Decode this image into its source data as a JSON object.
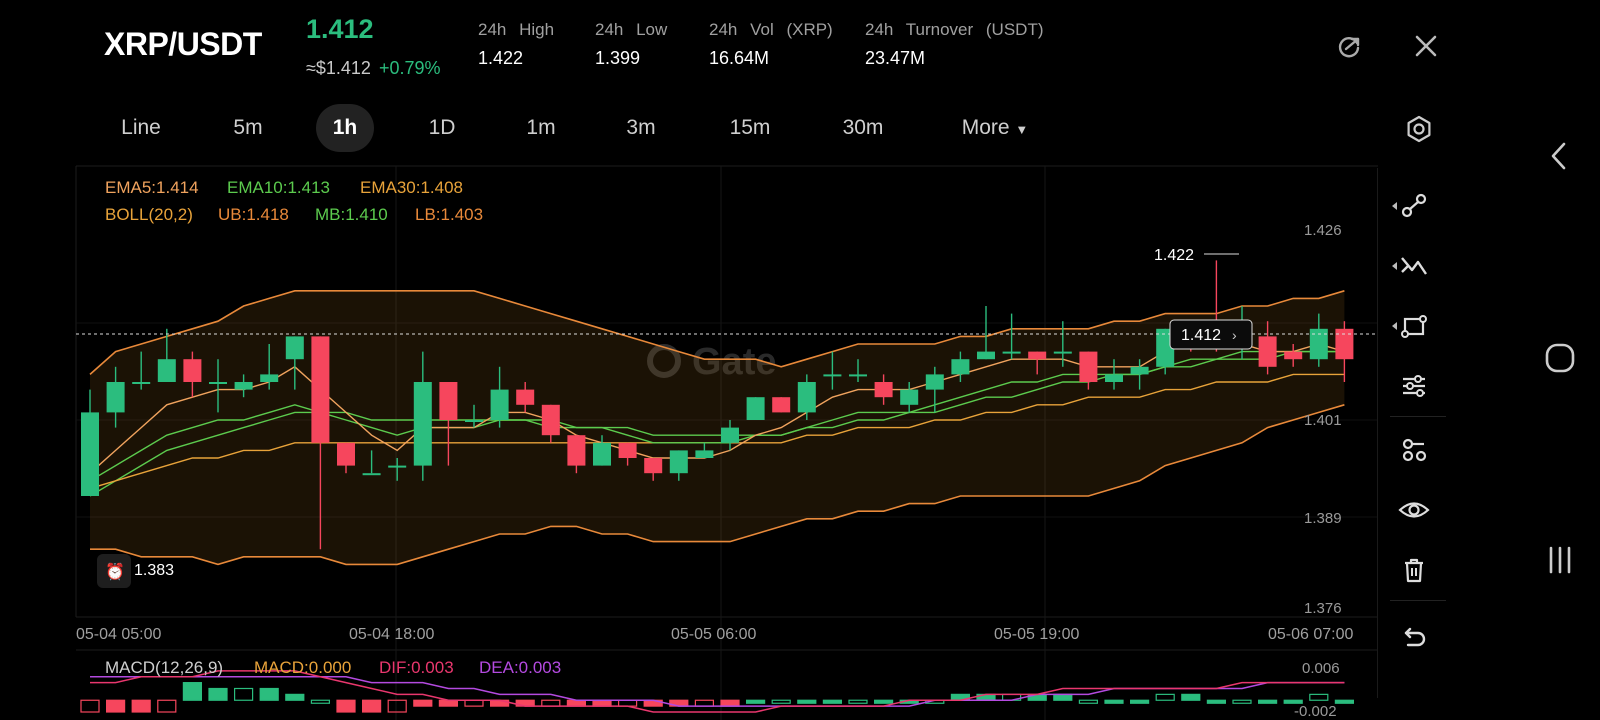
{
  "header": {
    "pair": "XRP/USDT",
    "price": "1.412",
    "usd_price": "≈$1.412",
    "change": "+0.79%",
    "stats": [
      {
        "label": "24h High",
        "value": "1.422"
      },
      {
        "label": "24h Low",
        "value": "1.399"
      },
      {
        "label": "24h Vol (XRP)",
        "value": "16.64M"
      },
      {
        "label": "24h Turnover (USDT)",
        "value": "23.47M"
      }
    ]
  },
  "intervals": [
    "Line",
    "5m",
    "1h",
    "1D",
    "1m",
    "3m",
    "15m",
    "30m",
    "More"
  ],
  "active_interval": "1h",
  "indicators": {
    "ema5": "EMA5:1.414",
    "ema10": "EMA10:1.413",
    "ema30": "EMA30:1.408",
    "boll": "BOLL(20,2)",
    "ub": "UB:1.418",
    "mb": "MB:1.410",
    "lb": "LB:1.403"
  },
  "macd": {
    "label": "MACD(12,26,9)",
    "macd": "MACD:0.000",
    "dif": "DIF:0.003",
    "dea": "DEA:0.003",
    "y_top": "0.006",
    "y_bottom": "-0.002"
  },
  "price_axis": [
    "1.426",
    "1.401",
    "1.389",
    "1.376"
  ],
  "time_axis": [
    "05-04 05:00",
    "05-04 18:00",
    "05-05 06:00",
    "05-05 19:00",
    "05-06 07:00"
  ],
  "markers": {
    "high": "1.422",
    "low": "1.383",
    "current": "1.412"
  },
  "watermark": "Gate",
  "colors": {
    "up": "#2bbd7e",
    "down": "#f6465d",
    "ema5": "#f0a35e",
    "ema10": "#5ccb4e",
    "ema30": "#e8a33a",
    "boll": "#e8893a",
    "dif": "#e9376e",
    "dea": "#b44ae0",
    "background": "#000000"
  },
  "toolbar_icons": [
    "draw-trend-icon",
    "draw-cross-icon",
    "draw-shape-icon",
    "indicator-settings-icon",
    "template-icon",
    "eye-icon",
    "trash-icon",
    "undo-icon"
  ],
  "chart_data": {
    "type": "candlestick",
    "interval": "1h",
    "ylim": [
      1.376,
      1.426
    ],
    "candles": [
      {
        "o": 1.391,
        "h": 1.405,
        "c": 1.402,
        "l": 1.391
      },
      {
        "o": 1.402,
        "h": 1.408,
        "c": 1.406,
        "l": 1.4
      },
      {
        "o": 1.406,
        "h": 1.41,
        "c": 1.406,
        "l": 1.405
      },
      {
        "o": 1.406,
        "h": 1.413,
        "c": 1.409,
        "l": 1.406
      },
      {
        "o": 1.409,
        "h": 1.41,
        "c": 1.406,
        "l": 1.404
      },
      {
        "o": 1.406,
        "h": 1.409,
        "c": 1.406,
        "l": 1.402
      },
      {
        "o": 1.405,
        "h": 1.407,
        "c": 1.406,
        "l": 1.404
      },
      {
        "o": 1.406,
        "h": 1.411,
        "c": 1.407,
        "l": 1.405
      },
      {
        "o": 1.409,
        "h": 1.412,
        "c": 1.412,
        "l": 1.405
      },
      {
        "o": 1.412,
        "h": 1.412,
        "c": 1.398,
        "l": 1.384
      },
      {
        "o": 1.398,
        "h": 1.398,
        "c": 1.395,
        "l": 1.394
      },
      {
        "o": 1.394,
        "h": 1.397,
        "c": 1.394,
        "l": 1.394
      },
      {
        "o": 1.395,
        "h": 1.396,
        "c": 1.395,
        "l": 1.393
      },
      {
        "o": 1.395,
        "h": 1.41,
        "c": 1.406,
        "l": 1.393
      },
      {
        "o": 1.406,
        "h": 1.406,
        "c": 1.401,
        "l": 1.395
      },
      {
        "o": 1.401,
        "h": 1.403,
        "c": 1.401,
        "l": 1.4
      },
      {
        "o": 1.401,
        "h": 1.408,
        "c": 1.405,
        "l": 1.4
      },
      {
        "o": 1.405,
        "h": 1.406,
        "c": 1.403,
        "l": 1.402
      },
      {
        "o": 1.403,
        "h": 1.403,
        "c": 1.399,
        "l": 1.398
      },
      {
        "o": 1.399,
        "h": 1.399,
        "c": 1.395,
        "l": 1.394
      },
      {
        "o": 1.395,
        "h": 1.399,
        "c": 1.398,
        "l": 1.395
      },
      {
        "o": 1.398,
        "h": 1.398,
        "c": 1.396,
        "l": 1.395
      },
      {
        "o": 1.396,
        "h": 1.396,
        "c": 1.394,
        "l": 1.393
      },
      {
        "o": 1.394,
        "h": 1.397,
        "c": 1.397,
        "l": 1.393
      },
      {
        "o": 1.396,
        "h": 1.398,
        "c": 1.397,
        "l": 1.396
      },
      {
        "o": 1.398,
        "h": 1.401,
        "c": 1.4,
        "l": 1.397
      },
      {
        "o": 1.401,
        "h": 1.404,
        "c": 1.404,
        "l": 1.401
      },
      {
        "o": 1.404,
        "h": 1.404,
        "c": 1.402,
        "l": 1.402
      },
      {
        "o": 1.402,
        "h": 1.407,
        "c": 1.406,
        "l": 1.401
      },
      {
        "o": 1.407,
        "h": 1.41,
        "c": 1.407,
        "l": 1.405
      },
      {
        "o": 1.407,
        "h": 1.409,
        "c": 1.407,
        "l": 1.406
      },
      {
        "o": 1.406,
        "h": 1.407,
        "c": 1.404,
        "l": 1.403
      },
      {
        "o": 1.403,
        "h": 1.406,
        "c": 1.405,
        "l": 1.402
      },
      {
        "o": 1.405,
        "h": 1.408,
        "c": 1.407,
        "l": 1.402
      },
      {
        "o": 1.407,
        "h": 1.41,
        "c": 1.409,
        "l": 1.406
      },
      {
        "o": 1.409,
        "h": 1.416,
        "c": 1.41,
        "l": 1.409
      },
      {
        "o": 1.41,
        "h": 1.415,
        "c": 1.41,
        "l": 1.409
      },
      {
        "o": 1.41,
        "h": 1.41,
        "c": 1.409,
        "l": 1.407
      },
      {
        "o": 1.41,
        "h": 1.414,
        "c": 1.41,
        "l": 1.408
      },
      {
        "o": 1.41,
        "h": 1.41,
        "c": 1.406,
        "l": 1.405
      },
      {
        "o": 1.406,
        "h": 1.409,
        "c": 1.407,
        "l": 1.405
      },
      {
        "o": 1.407,
        "h": 1.409,
        "c": 1.408,
        "l": 1.405
      },
      {
        "o": 1.408,
        "h": 1.413,
        "c": 1.413,
        "l": 1.407
      },
      {
        "o": 1.413,
        "h": 1.414,
        "c": 1.412,
        "l": 1.41
      },
      {
        "o": 1.412,
        "h": 1.422,
        "c": 1.411,
        "l": 1.41
      },
      {
        "o": 1.411,
        "h": 1.416,
        "c": 1.412,
        "l": 1.409
      },
      {
        "o": 1.412,
        "h": 1.414,
        "c": 1.408,
        "l": 1.407
      },
      {
        "o": 1.41,
        "h": 1.411,
        "c": 1.409,
        "l": 1.408
      },
      {
        "o": 1.409,
        "h": 1.415,
        "c": 1.413,
        "l": 1.408
      },
      {
        "o": 1.413,
        "h": 1.414,
        "c": 1.409,
        "l": 1.406
      }
    ],
    "ema5": [
      1.394,
      1.397,
      1.4,
      1.403,
      1.404,
      1.405,
      1.405,
      1.406,
      1.408,
      1.405,
      1.402,
      1.399,
      1.397,
      1.4,
      1.4,
      1.4,
      1.402,
      1.402,
      1.401,
      1.399,
      1.398,
      1.397,
      1.396,
      1.396,
      1.396,
      1.397,
      1.399,
      1.4,
      1.402,
      1.404,
      1.405,
      1.405,
      1.405,
      1.406,
      1.407,
      1.408,
      1.409,
      1.409,
      1.409,
      1.408,
      1.408,
      1.408,
      1.41,
      1.411,
      1.411,
      1.411,
      1.41,
      1.41,
      1.411,
      1.41
    ],
    "ema10": [
      1.393,
      1.395,
      1.397,
      1.399,
      1.4,
      1.401,
      1.401,
      1.402,
      1.403,
      1.402,
      1.401,
      1.4,
      1.399,
      1.4,
      1.4,
      1.4,
      1.401,
      1.401,
      1.401,
      1.4,
      1.4,
      1.399,
      1.398,
      1.398,
      1.398,
      1.398,
      1.399,
      1.399,
      1.4,
      1.401,
      1.402,
      1.402,
      1.402,
      1.403,
      1.404,
      1.405,
      1.406,
      1.406,
      1.407,
      1.407,
      1.407,
      1.407,
      1.408,
      1.409,
      1.409,
      1.41,
      1.41,
      1.41,
      1.41,
      1.41
    ],
    "ema30": [
      1.392,
      1.393,
      1.394,
      1.395,
      1.396,
      1.396,
      1.397,
      1.397,
      1.398,
      1.398,
      1.398,
      1.398,
      1.398,
      1.398,
      1.398,
      1.398,
      1.398,
      1.398,
      1.398,
      1.398,
      1.398,
      1.398,
      1.398,
      1.398,
      1.398,
      1.398,
      1.398,
      1.398,
      1.399,
      1.399,
      1.4,
      1.4,
      1.4,
      1.401,
      1.401,
      1.402,
      1.402,
      1.403,
      1.403,
      1.404,
      1.404,
      1.404,
      1.405,
      1.405,
      1.406,
      1.406,
      1.406,
      1.407,
      1.407,
      1.407
    ],
    "boll_ub": [
      1.407,
      1.41,
      1.411,
      1.412,
      1.413,
      1.414,
      1.416,
      1.417,
      1.418,
      1.418,
      1.418,
      1.418,
      1.418,
      1.418,
      1.418,
      1.418,
      1.417,
      1.416,
      1.415,
      1.414,
      1.413,
      1.412,
      1.411,
      1.41,
      1.409,
      1.409,
      1.409,
      1.408,
      1.409,
      1.41,
      1.411,
      1.411,
      1.411,
      1.411,
      1.412,
      1.412,
      1.413,
      1.413,
      1.413,
      1.413,
      1.414,
      1.414,
      1.415,
      1.415,
      1.415,
      1.416,
      1.416,
      1.417,
      1.417,
      1.418
    ],
    "boll_mb": [
      1.391,
      1.393,
      1.395,
      1.397,
      1.398,
      1.399,
      1.4,
      1.401,
      1.402,
      1.402,
      1.402,
      1.401,
      1.401,
      1.401,
      1.401,
      1.401,
      1.401,
      1.401,
      1.4,
      1.4,
      1.4,
      1.4,
      1.399,
      1.399,
      1.399,
      1.399,
      1.399,
      1.399,
      1.4,
      1.4,
      1.401,
      1.401,
      1.402,
      1.402,
      1.403,
      1.404,
      1.404,
      1.405,
      1.406,
      1.406,
      1.407,
      1.407,
      1.408,
      1.408,
      1.409,
      1.409,
      1.409,
      1.41,
      1.41,
      1.41
    ],
    "boll_lb": [
      1.384,
      1.384,
      1.383,
      1.383,
      1.383,
      1.382,
      1.383,
      1.383,
      1.383,
      1.383,
      1.382,
      1.382,
      1.382,
      1.383,
      1.384,
      1.385,
      1.386,
      1.386,
      1.387,
      1.387,
      1.386,
      1.386,
      1.385,
      1.385,
      1.385,
      1.385,
      1.386,
      1.387,
      1.388,
      1.388,
      1.389,
      1.389,
      1.39,
      1.39,
      1.391,
      1.391,
      1.391,
      1.391,
      1.391,
      1.391,
      1.392,
      1.393,
      1.395,
      1.396,
      1.397,
      1.398,
      1.4,
      1.401,
      1.402,
      1.403
    ],
    "macd_hist": [
      -0.002,
      -0.002,
      -0.002,
      -0.002,
      0.003,
      0.002,
      0.002,
      0.002,
      0.001,
      0.0,
      -0.002,
      -0.002,
      -0.002,
      -0.001,
      -0.001,
      -0.001,
      -0.001,
      -0.001,
      -0.001,
      -0.001,
      -0.001,
      -0.001,
      -0.001,
      -0.001,
      -0.001,
      -0.001,
      0.0,
      0.0,
      0.0,
      0.0,
      0.0,
      0.0,
      0.0,
      0.0,
      0.001,
      0.001,
      0.001,
      0.001,
      0.001,
      0.0,
      0.0,
      0.0,
      0.001,
      0.001,
      0.0,
      0.0,
      0.0,
      0.0,
      0.001,
      0.0
    ],
    "dif": [
      0.003,
      0.003,
      0.004,
      0.004,
      0.004,
      0.005,
      0.005,
      0.005,
      0.005,
      0.004,
      0.003,
      0.002,
      0.001,
      0.001,
      0.0,
      0.0,
      0.0,
      -0.001,
      -0.001,
      -0.001,
      -0.001,
      -0.001,
      -0.002,
      -0.002,
      -0.002,
      -0.002,
      -0.002,
      -0.001,
      -0.001,
      -0.001,
      -0.001,
      -0.001,
      0.0,
      0.0,
      0.0,
      0.001,
      0.001,
      0.001,
      0.002,
      0.002,
      0.002,
      0.002,
      0.002,
      0.002,
      0.002,
      0.003,
      0.003,
      0.003,
      0.003,
      0.003
    ],
    "dea": [
      0.004,
      0.004,
      0.004,
      0.004,
      0.004,
      0.004,
      0.004,
      0.004,
      0.004,
      0.004,
      0.004,
      0.003,
      0.003,
      0.003,
      0.002,
      0.002,
      0.001,
      0.001,
      0.001,
      0.0,
      0.0,
      0.0,
      0.0,
      -0.001,
      -0.001,
      -0.001,
      -0.001,
      -0.001,
      -0.001,
      -0.001,
      -0.001,
      -0.001,
      -0.001,
      0.0,
      0.0,
      0.0,
      0.0,
      0.001,
      0.001,
      0.001,
      0.002,
      0.002,
      0.002,
      0.002,
      0.002,
      0.002,
      0.003,
      0.003,
      0.003,
      0.003
    ]
  }
}
